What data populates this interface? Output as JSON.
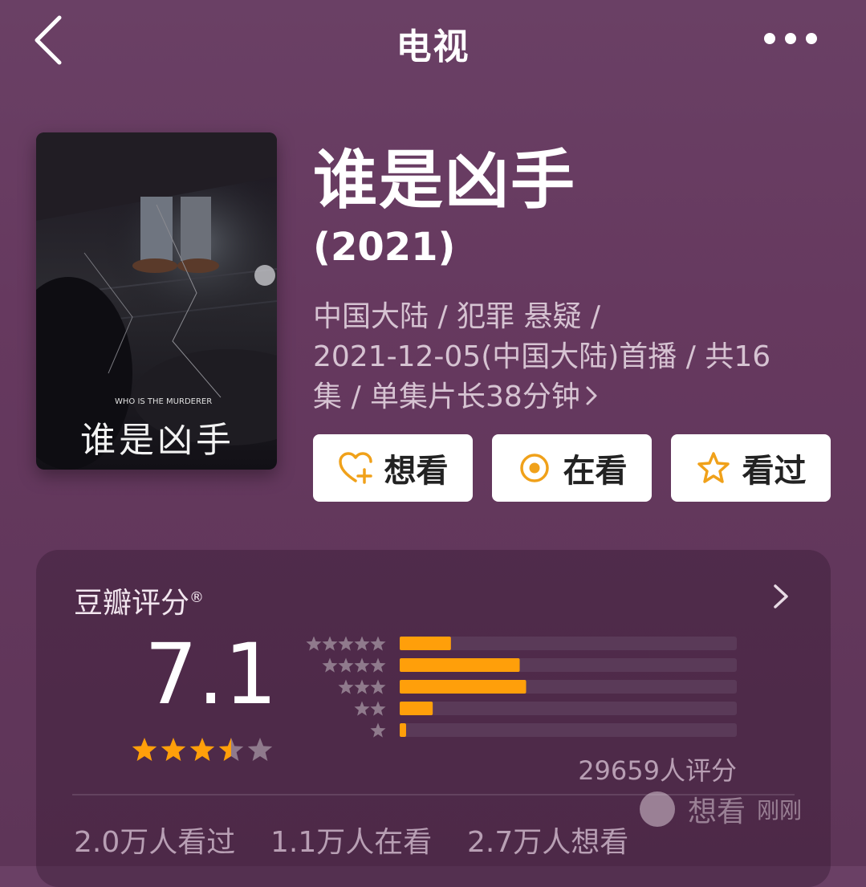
{
  "header": {
    "title": "电视"
  },
  "movie": {
    "title": "谁是凶手",
    "year": "(2021)",
    "meta_line1": "中国大陆 / 犯罪 悬疑 /",
    "meta_line2": "2021-12-05(中国大陆)首播 / 共16",
    "meta_line3": "集 / 单集片长38分钟",
    "poster_tagline": "WHO IS THE MURDERER",
    "poster_title": "谁是凶手"
  },
  "actions": {
    "want": "想看",
    "doing": "在看",
    "done": "看过"
  },
  "rating": {
    "title": "豆瓣评分",
    "mark": "®",
    "score": "7.1",
    "stars": 3.5,
    "total": "29659人评分",
    "stats": {
      "watched": "2.0万人看过",
      "watching": "1.1万人在看",
      "want": "2.7万人想看"
    },
    "toast": {
      "text": "想看",
      "time": "刚刚"
    }
  },
  "chart_data": {
    "type": "bar",
    "categories": [
      "5星",
      "4星",
      "3星",
      "2星",
      "1星"
    ],
    "values": [
      15.2,
      35.6,
      37.5,
      9.8,
      1.9
    ],
    "ylim": [
      0,
      100
    ]
  },
  "colors": {
    "accent": "#ff9f0a",
    "track": "#5a3a58",
    "star_empty": "#8f7a8c"
  }
}
